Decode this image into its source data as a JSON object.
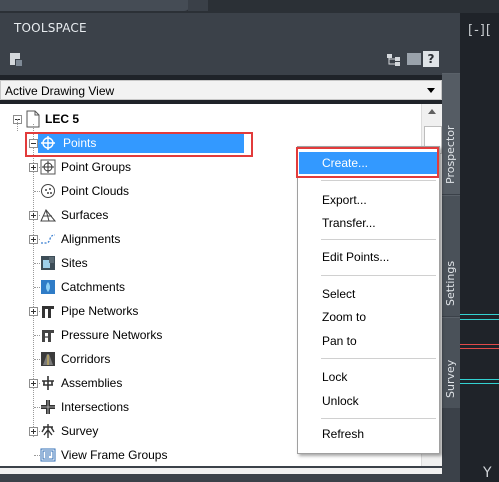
{
  "palette": {
    "title": "TOOLSPACE",
    "help_label": "?"
  },
  "view_selector": {
    "selected": "Active Drawing View"
  },
  "tree": {
    "root": "LEC 5",
    "items": [
      {
        "label": "Points",
        "icon": "points-icon",
        "expander": "minus",
        "selected": true
      },
      {
        "label": "Point Groups",
        "icon": "point-groups-icon",
        "expander": "plus"
      },
      {
        "label": "Point Clouds",
        "icon": "point-clouds-icon",
        "expander": "none"
      },
      {
        "label": "Surfaces",
        "icon": "surfaces-icon",
        "expander": "plus"
      },
      {
        "label": "Alignments",
        "icon": "alignments-icon",
        "expander": "plus"
      },
      {
        "label": "Sites",
        "icon": "sites-icon",
        "expander": "none"
      },
      {
        "label": "Catchments",
        "icon": "catchments-icon",
        "expander": "none"
      },
      {
        "label": "Pipe Networks",
        "icon": "pipe-networks-icon",
        "expander": "plus"
      },
      {
        "label": "Pressure Networks",
        "icon": "pressure-networks-icon",
        "expander": "none"
      },
      {
        "label": "Corridors",
        "icon": "corridors-icon",
        "expander": "none"
      },
      {
        "label": "Assemblies",
        "icon": "assemblies-icon",
        "expander": "plus"
      },
      {
        "label": "Intersections",
        "icon": "intersections-icon",
        "expander": "none"
      },
      {
        "label": "Survey",
        "icon": "survey-icon",
        "expander": "plus"
      },
      {
        "label": "View Frame Groups",
        "icon": "view-frame-groups-icon",
        "expander": "none"
      }
    ]
  },
  "side_tabs": {
    "prospector": "Prospector",
    "settings": "Settings",
    "survey": "Survey"
  },
  "context_menu": {
    "create": "Create...",
    "export": "Export...",
    "transfer": "Transfer...",
    "edit_points": "Edit Points...",
    "select": "Select",
    "zoom_to": "Zoom to",
    "pan_to": "Pan to",
    "lock": "Lock",
    "unlock": "Unlock",
    "refresh": "Refresh"
  },
  "drawing_area": {
    "header": "[-][",
    "ucs_label": "Y"
  },
  "colors": {
    "selection": "#3399ff",
    "highlight_box": "#e23b3b",
    "panel_dark": "#3b4149",
    "drawing_bg": "#1f2329"
  }
}
